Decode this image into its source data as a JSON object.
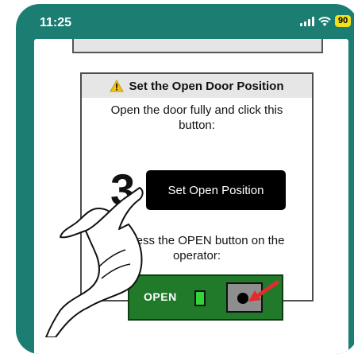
{
  "status_bar": {
    "time": "11:25",
    "battery": "90",
    "icons": [
      "signal-icon",
      "wifi-icon",
      "battery-icon"
    ]
  },
  "card": {
    "warning_icon": "⚠",
    "title": "Set the Open Door Position",
    "instruction": "Open the door fully and click this button:",
    "step_number": "3",
    "button_label": "Set Open Position",
    "alt_instruction": "Or press the OPEN button on the operator:",
    "operator_label": "OPEN"
  },
  "colors": {
    "header_bg": "#1c7e72",
    "operator_panel": "#217a2a",
    "arrow": "#e32b2b",
    "button_bg": "#000000"
  }
}
